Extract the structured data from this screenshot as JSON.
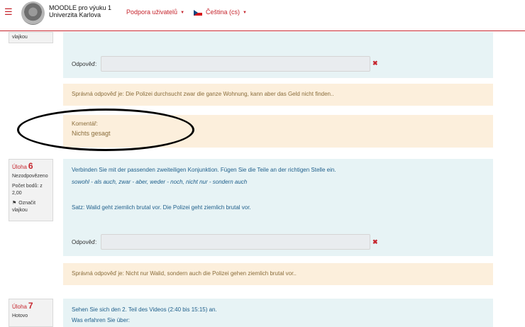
{
  "header": {
    "site_name_line1": "MOODLE pro výuku 1",
    "site_name_line2": "Univerzita Karlova",
    "support_label": "Podpora uživatelů",
    "language_label": "Čeština (cs)"
  },
  "q5_sidebar": {
    "flag_text": "vlajkou"
  },
  "q5": {
    "answer_label": "Odpověď:",
    "correct_answer": "Správná odpověď je: Die Polizei durchsucht zwar die ganze Wohnung, kann aber das Geld nicht finden..",
    "comment_label": "Komentář:",
    "comment_text": "Nichts gesagt"
  },
  "q6_sidebar": {
    "title": "Úloha",
    "number": "6",
    "status": "Nezodpovězeno",
    "points": "Počet bodů: z 2,00",
    "flag_label": "Označit vlajkou"
  },
  "q6": {
    "instruction": "Verbinden Sie mit der passenden zweiteiligen Konjunktion. Fügen Sie die Teile an der richtigen Stelle ein.",
    "conjunctions": "sowohl - als auch, zwar - aber, weder - noch, nicht nur - sondern auch",
    "sentence": "Satz: Walid geht ziemlich brutal vor. Die Polizei geht ziemlich brutal vor.",
    "answer_label": "Odpověď:",
    "correct_answer": "Správná odpověď je: Nicht nur Walid, sondern auch die Polizei gehen ziemlich brutal vor.."
  },
  "q7_sidebar": {
    "title": "Úloha",
    "number": "7",
    "status": "Hotovo"
  },
  "q7": {
    "instruction": "Sehen Sie sich den 2. Teil des Videos (2:40 bis 15:15) an.",
    "question": "Was erfahren Sie über:"
  },
  "colors": {
    "accent": "#c6262e",
    "content_bg": "#e7f3f5",
    "feedback_bg": "#fcefdc"
  }
}
